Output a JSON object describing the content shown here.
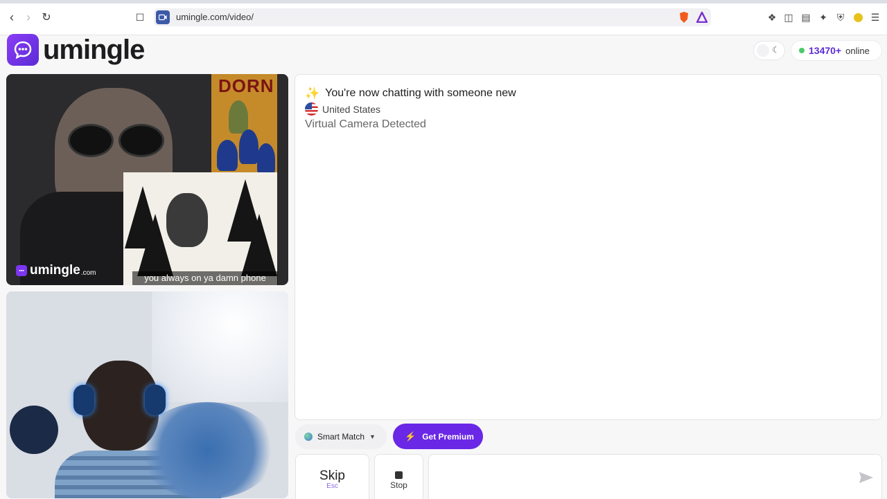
{
  "browser": {
    "url": "umingle.com/video/"
  },
  "icons": {
    "back": "arrow-left-icon",
    "forward": "arrow-right-icon",
    "reload": "reload-icon",
    "bookmark": "bookmark-icon",
    "site": "video-camera-icon",
    "brave": "brave-shield-icon",
    "rewards": "brave-rewards-icon",
    "extensions": "puzzle-icon",
    "sidebar": "sidebar-icon",
    "wallet": "wallet-icon",
    "leo": "sparkle-icon",
    "vpn": "shield-icon",
    "profile": "profile-icon",
    "menu": "hamburger-menu-icon"
  },
  "header": {
    "logo_text": "umingle",
    "online_count": "13470+",
    "online_label": "online"
  },
  "remote_video": {
    "watermark_text": "umingle",
    "watermark_suffix": ".com",
    "meme_title": "DORN",
    "caption": "you always on ya damn phone"
  },
  "chat": {
    "title": "You're now chatting with someone new",
    "country": "United States",
    "notice": "Virtual Camera Detected"
  },
  "controls": {
    "smart_match_label": "Smart Match",
    "premium_label": "Get Premium",
    "skip_label": "Skip",
    "skip_key": "Esc",
    "stop_label": "Stop",
    "message_placeholder": ""
  },
  "colors": {
    "brand_purple": "#6a27e6",
    "online_green": "#4cc96b",
    "online_count": "#5b2bd6"
  }
}
